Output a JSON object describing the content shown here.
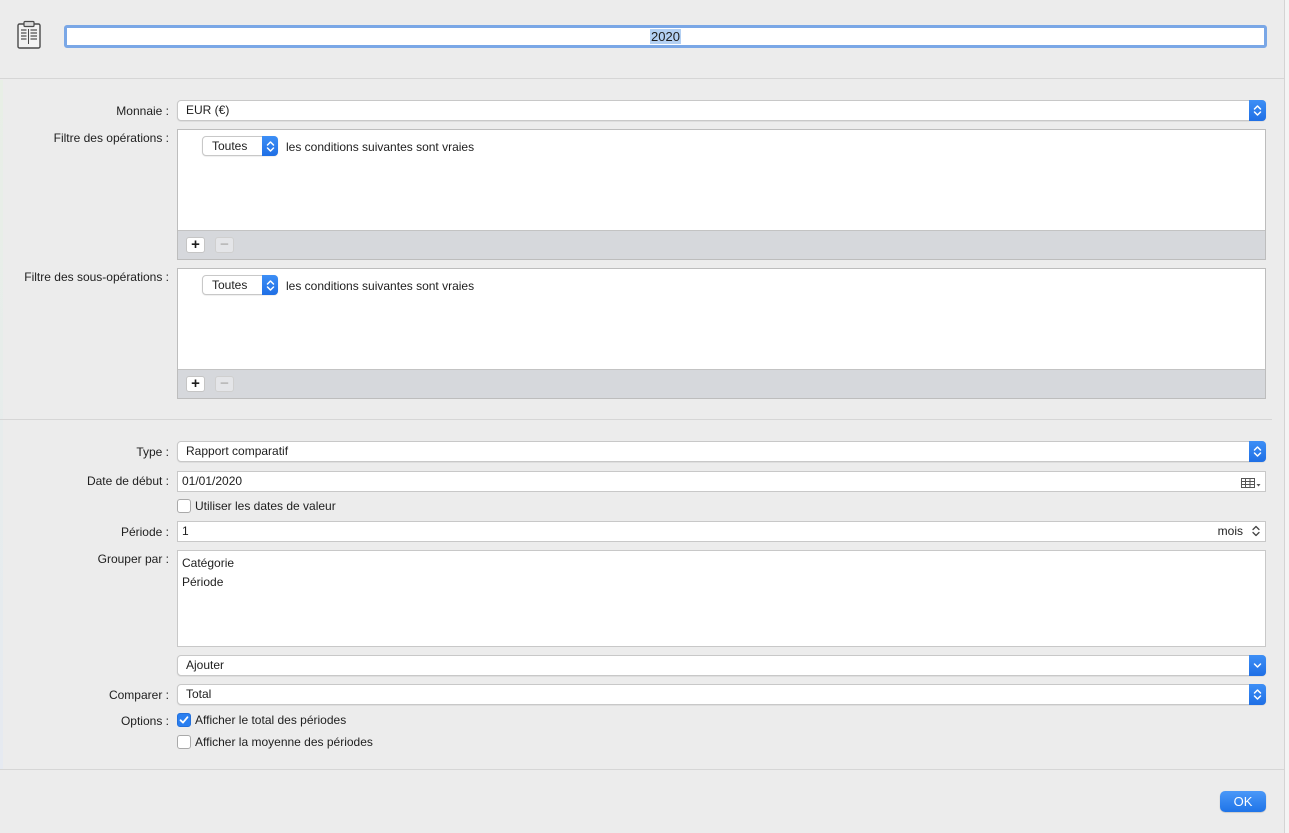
{
  "header": {
    "title_value": "2020"
  },
  "labels": {
    "currency": "Monnaie :",
    "op_filter": "Filtre des opérations :",
    "subop_filter": "Filtre des sous-opérations :",
    "type": "Type :",
    "start_date": "Date de début :",
    "period": "Période :",
    "group_by": "Grouper par :",
    "compare": "Comparer :",
    "options": "Options :"
  },
  "currency": {
    "selected": "EUR (€)"
  },
  "op_filter": {
    "match": "Toutes",
    "condition_text": "les conditions suivantes sont vraies",
    "add": "+",
    "remove": "−"
  },
  "subop_filter": {
    "match": "Toutes",
    "condition_text": "les conditions suivantes sont vraies",
    "add": "+",
    "remove": "−"
  },
  "type": {
    "selected": "Rapport comparatif"
  },
  "start_date": {
    "value": "01/01/2020"
  },
  "value_dates": {
    "label": "Utiliser les dates de valeur",
    "checked": false
  },
  "period": {
    "value": "1",
    "unit": "mois"
  },
  "group_by": {
    "items": [
      "Catégorie",
      "Période"
    ]
  },
  "add_group": {
    "selected": "Ajouter"
  },
  "compare": {
    "selected": "Total"
  },
  "options": {
    "show_total": {
      "label": "Afficher le total des périodes",
      "checked": true
    },
    "show_average": {
      "label": "Afficher la moyenne des périodes",
      "checked": false
    }
  },
  "footer": {
    "ok_label": "OK"
  },
  "colors": {
    "accent": "#1f74e8",
    "selection": "#b3d0f3",
    "focus_ring": "#7aa7e6"
  }
}
